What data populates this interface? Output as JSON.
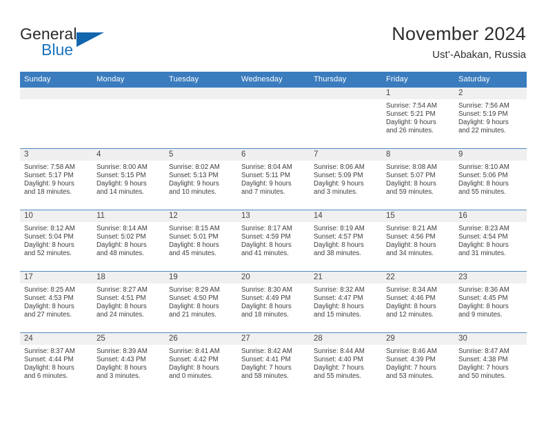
{
  "brand": {
    "word_general": "General",
    "word_blue": "Blue",
    "accent_color": "#1266ad"
  },
  "header": {
    "title": "November 2024",
    "subtitle": "Ust’-Abakan, Russia"
  },
  "calendar": {
    "header_color": "#3a7cbe",
    "weekdays": [
      "Sunday",
      "Monday",
      "Tuesday",
      "Wednesday",
      "Thursday",
      "Friday",
      "Saturday"
    ],
    "weeks": [
      [
        {
          "day": "",
          "sunrise": "",
          "sunset": "",
          "daylight_1": "",
          "daylight_2": ""
        },
        {
          "day": "",
          "sunrise": "",
          "sunset": "",
          "daylight_1": "",
          "daylight_2": ""
        },
        {
          "day": "",
          "sunrise": "",
          "sunset": "",
          "daylight_1": "",
          "daylight_2": ""
        },
        {
          "day": "",
          "sunrise": "",
          "sunset": "",
          "daylight_1": "",
          "daylight_2": ""
        },
        {
          "day": "",
          "sunrise": "",
          "sunset": "",
          "daylight_1": "",
          "daylight_2": ""
        },
        {
          "day": "1",
          "sunrise": "Sunrise: 7:54 AM",
          "sunset": "Sunset: 5:21 PM",
          "daylight_1": "Daylight: 9 hours",
          "daylight_2": "and 26 minutes."
        },
        {
          "day": "2",
          "sunrise": "Sunrise: 7:56 AM",
          "sunset": "Sunset: 5:19 PM",
          "daylight_1": "Daylight: 9 hours",
          "daylight_2": "and 22 minutes."
        }
      ],
      [
        {
          "day": "3",
          "sunrise": "Sunrise: 7:58 AM",
          "sunset": "Sunset: 5:17 PM",
          "daylight_1": "Daylight: 9 hours",
          "daylight_2": "and 18 minutes."
        },
        {
          "day": "4",
          "sunrise": "Sunrise: 8:00 AM",
          "sunset": "Sunset: 5:15 PM",
          "daylight_1": "Daylight: 9 hours",
          "daylight_2": "and 14 minutes."
        },
        {
          "day": "5",
          "sunrise": "Sunrise: 8:02 AM",
          "sunset": "Sunset: 5:13 PM",
          "daylight_1": "Daylight: 9 hours",
          "daylight_2": "and 10 minutes."
        },
        {
          "day": "6",
          "sunrise": "Sunrise: 8:04 AM",
          "sunset": "Sunset: 5:11 PM",
          "daylight_1": "Daylight: 9 hours",
          "daylight_2": "and 7 minutes."
        },
        {
          "day": "7",
          "sunrise": "Sunrise: 8:06 AM",
          "sunset": "Sunset: 5:09 PM",
          "daylight_1": "Daylight: 9 hours",
          "daylight_2": "and 3 minutes."
        },
        {
          "day": "8",
          "sunrise": "Sunrise: 8:08 AM",
          "sunset": "Sunset: 5:07 PM",
          "daylight_1": "Daylight: 8 hours",
          "daylight_2": "and 59 minutes."
        },
        {
          "day": "9",
          "sunrise": "Sunrise: 8:10 AM",
          "sunset": "Sunset: 5:06 PM",
          "daylight_1": "Daylight: 8 hours",
          "daylight_2": "and 55 minutes."
        }
      ],
      [
        {
          "day": "10",
          "sunrise": "Sunrise: 8:12 AM",
          "sunset": "Sunset: 5:04 PM",
          "daylight_1": "Daylight: 8 hours",
          "daylight_2": "and 52 minutes."
        },
        {
          "day": "11",
          "sunrise": "Sunrise: 8:14 AM",
          "sunset": "Sunset: 5:02 PM",
          "daylight_1": "Daylight: 8 hours",
          "daylight_2": "and 48 minutes."
        },
        {
          "day": "12",
          "sunrise": "Sunrise: 8:15 AM",
          "sunset": "Sunset: 5:01 PM",
          "daylight_1": "Daylight: 8 hours",
          "daylight_2": "and 45 minutes."
        },
        {
          "day": "13",
          "sunrise": "Sunrise: 8:17 AM",
          "sunset": "Sunset: 4:59 PM",
          "daylight_1": "Daylight: 8 hours",
          "daylight_2": "and 41 minutes."
        },
        {
          "day": "14",
          "sunrise": "Sunrise: 8:19 AM",
          "sunset": "Sunset: 4:57 PM",
          "daylight_1": "Daylight: 8 hours",
          "daylight_2": "and 38 minutes."
        },
        {
          "day": "15",
          "sunrise": "Sunrise: 8:21 AM",
          "sunset": "Sunset: 4:56 PM",
          "daylight_1": "Daylight: 8 hours",
          "daylight_2": "and 34 minutes."
        },
        {
          "day": "16",
          "sunrise": "Sunrise: 8:23 AM",
          "sunset": "Sunset: 4:54 PM",
          "daylight_1": "Daylight: 8 hours",
          "daylight_2": "and 31 minutes."
        }
      ],
      [
        {
          "day": "17",
          "sunrise": "Sunrise: 8:25 AM",
          "sunset": "Sunset: 4:53 PM",
          "daylight_1": "Daylight: 8 hours",
          "daylight_2": "and 27 minutes."
        },
        {
          "day": "18",
          "sunrise": "Sunrise: 8:27 AM",
          "sunset": "Sunset: 4:51 PM",
          "daylight_1": "Daylight: 8 hours",
          "daylight_2": "and 24 minutes."
        },
        {
          "day": "19",
          "sunrise": "Sunrise: 8:29 AM",
          "sunset": "Sunset: 4:50 PM",
          "daylight_1": "Daylight: 8 hours",
          "daylight_2": "and 21 minutes."
        },
        {
          "day": "20",
          "sunrise": "Sunrise: 8:30 AM",
          "sunset": "Sunset: 4:49 PM",
          "daylight_1": "Daylight: 8 hours",
          "daylight_2": "and 18 minutes."
        },
        {
          "day": "21",
          "sunrise": "Sunrise: 8:32 AM",
          "sunset": "Sunset: 4:47 PM",
          "daylight_1": "Daylight: 8 hours",
          "daylight_2": "and 15 minutes."
        },
        {
          "day": "22",
          "sunrise": "Sunrise: 8:34 AM",
          "sunset": "Sunset: 4:46 PM",
          "daylight_1": "Daylight: 8 hours",
          "daylight_2": "and 12 minutes."
        },
        {
          "day": "23",
          "sunrise": "Sunrise: 8:36 AM",
          "sunset": "Sunset: 4:45 PM",
          "daylight_1": "Daylight: 8 hours",
          "daylight_2": "and 9 minutes."
        }
      ],
      [
        {
          "day": "24",
          "sunrise": "Sunrise: 8:37 AM",
          "sunset": "Sunset: 4:44 PM",
          "daylight_1": "Daylight: 8 hours",
          "daylight_2": "and 6 minutes."
        },
        {
          "day": "25",
          "sunrise": "Sunrise: 8:39 AM",
          "sunset": "Sunset: 4:43 PM",
          "daylight_1": "Daylight: 8 hours",
          "daylight_2": "and 3 minutes."
        },
        {
          "day": "26",
          "sunrise": "Sunrise: 8:41 AM",
          "sunset": "Sunset: 4:42 PM",
          "daylight_1": "Daylight: 8 hours",
          "daylight_2": "and 0 minutes."
        },
        {
          "day": "27",
          "sunrise": "Sunrise: 8:42 AM",
          "sunset": "Sunset: 4:41 PM",
          "daylight_1": "Daylight: 7 hours",
          "daylight_2": "and 58 minutes."
        },
        {
          "day": "28",
          "sunrise": "Sunrise: 8:44 AM",
          "sunset": "Sunset: 4:40 PM",
          "daylight_1": "Daylight: 7 hours",
          "daylight_2": "and 55 minutes."
        },
        {
          "day": "29",
          "sunrise": "Sunrise: 8:46 AM",
          "sunset": "Sunset: 4:39 PM",
          "daylight_1": "Daylight: 7 hours",
          "daylight_2": "and 53 minutes."
        },
        {
          "day": "30",
          "sunrise": "Sunrise: 8:47 AM",
          "sunset": "Sunset: 4:38 PM",
          "daylight_1": "Daylight: 7 hours",
          "daylight_2": "and 50 minutes."
        }
      ]
    ]
  }
}
